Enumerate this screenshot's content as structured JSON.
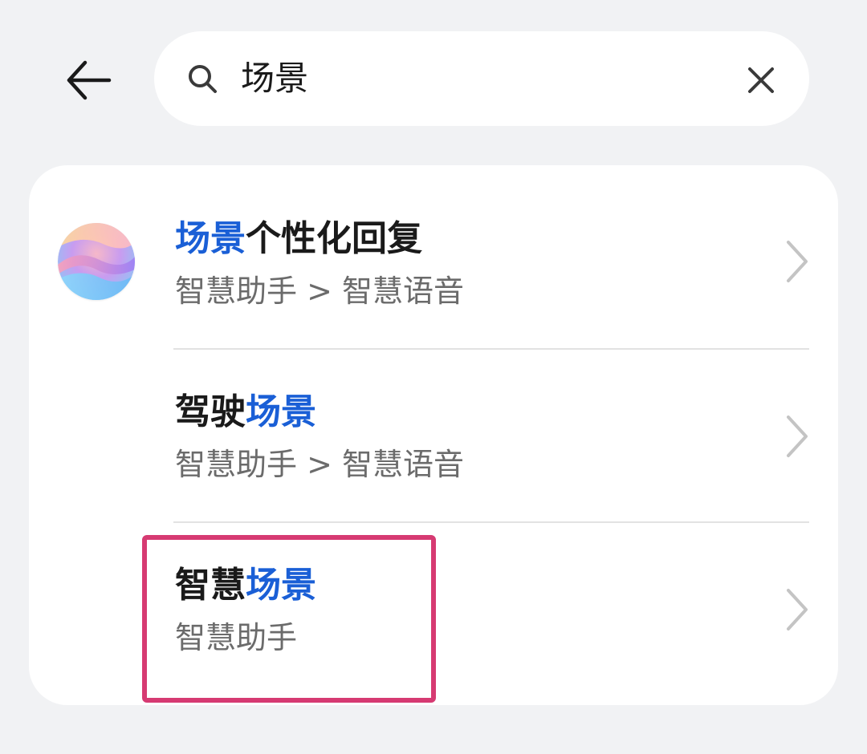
{
  "header": {
    "back_icon": "arrow-left-icon",
    "search": {
      "value": "场景",
      "placeholder": "",
      "icon": "search-icon",
      "clear_icon": "close-icon"
    }
  },
  "results": [
    {
      "title_parts": [
        {
          "text": "场景",
          "highlight": true
        },
        {
          "text": "个性化回复",
          "highlight": false
        }
      ],
      "path": "智慧助手 > 智慧语音",
      "icon": "smart-assistant-icon",
      "chevron_icon": "chevron-right-icon"
    },
    {
      "title_parts": [
        {
          "text": "驾驶",
          "highlight": false
        },
        {
          "text": "场景",
          "highlight": true
        }
      ],
      "path": "智慧助手 > 智慧语音",
      "icon": null,
      "chevron_icon": "chevron-right-icon"
    },
    {
      "title_parts": [
        {
          "text": "智慧",
          "highlight": false
        },
        {
          "text": "场景",
          "highlight": true
        }
      ],
      "path": "智慧助手",
      "icon": null,
      "chevron_icon": "chevron-right-icon",
      "annotated": true
    }
  ],
  "colors": {
    "background": "#f1f2f4",
    "card": "#ffffff",
    "highlight_text": "#1a5fd6",
    "primary_text": "#1a1a1a",
    "secondary_text": "#6b6b6b",
    "annotation_box": "#d63a72"
  }
}
